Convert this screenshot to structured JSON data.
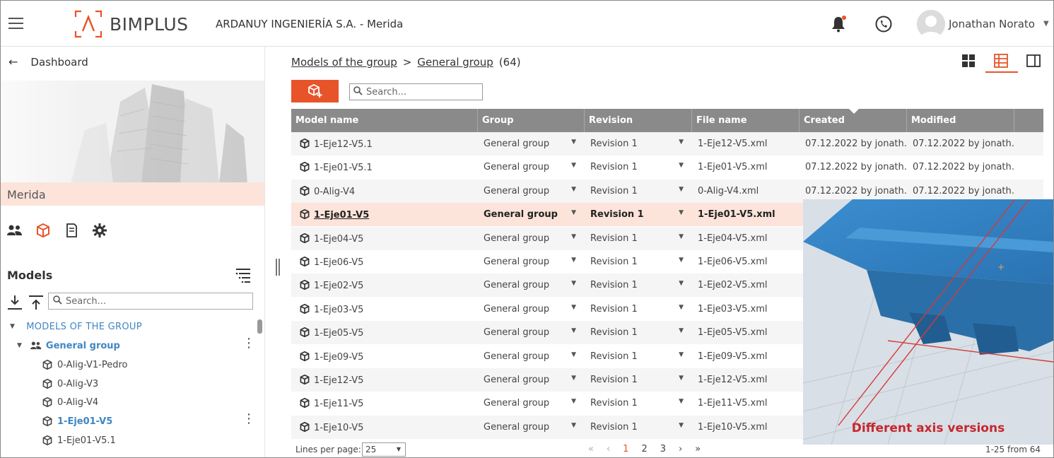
{
  "header": {
    "logo_text": "BIMPLUS",
    "company": "ARDANUY INGENIERÍA S.A.  -  Merida",
    "user_name": "Jonathan Norato"
  },
  "sidebar": {
    "back_label": "Dashboard",
    "project_name": "Merida",
    "models_title": "Models",
    "search_placeholder": "Search...",
    "tree": {
      "root_label": "MODELS OF THE GROUP",
      "group_label": "General group",
      "models": [
        "0-Alig-V1-Pedro",
        "0-Alig-V3",
        "0-Alig-V4",
        "1-Eje01-V5",
        "1-Eje01-V5.1"
      ],
      "selected_model": "1-Eje01-V5"
    }
  },
  "main": {
    "breadcrumb": {
      "root": "Models of the group",
      "separator": ">",
      "current": "General group",
      "count": "(64)"
    },
    "search_placeholder": "Search...",
    "columns": [
      "Model name",
      "Group",
      "Revision",
      "File name",
      "Created",
      "Modified"
    ],
    "rows": [
      {
        "name": "1-Eje12-V5.1",
        "group": "General group",
        "revision": "Revision 1",
        "file": "1-Eje12-V5.xml",
        "created": "07.12.2022 by jonath…",
        "modified": "07.12.2022 by jonath…"
      },
      {
        "name": "1-Eje01-V5.1",
        "group": "General group",
        "revision": "Revision 1",
        "file": "1-Eje01-V5.xml",
        "created": "07.12.2022 by jonath…",
        "modified": "07.12.2022 by jonath…"
      },
      {
        "name": "0-Alig-V4",
        "group": "General group",
        "revision": "Revision 1",
        "file": "0-Alig-V4.xml",
        "created": "07.12.2022 by jonath…",
        "modified": "07.12.2022 by jonath…"
      },
      {
        "name": "1-Eje01-V5",
        "group": "General group",
        "revision": "Revision 1",
        "file": "1-Eje01-V5.xml",
        "created": "",
        "modified": ""
      },
      {
        "name": "1-Eje04-V5",
        "group": "General group",
        "revision": "Revision 1",
        "file": "1-Eje04-V5.xml",
        "created": "",
        "modified": ""
      },
      {
        "name": "1-Eje06-V5",
        "group": "General group",
        "revision": "Revision 1",
        "file": "1-Eje06-V5.xml",
        "created": "",
        "modified": ""
      },
      {
        "name": "1-Eje02-V5",
        "group": "General group",
        "revision": "Revision 1",
        "file": "1-Eje02-V5.xml",
        "created": "",
        "modified": ""
      },
      {
        "name": "1-Eje03-V5",
        "group": "General group",
        "revision": "Revision 1",
        "file": "1-Eje03-V5.xml",
        "created": "",
        "modified": ""
      },
      {
        "name": "1-Eje05-V5",
        "group": "General group",
        "revision": "Revision 1",
        "file": "1-Eje05-V5.xml",
        "created": "",
        "modified": ""
      },
      {
        "name": "1-Eje09-V5",
        "group": "General group",
        "revision": "Revision 1",
        "file": "1-Eje09-V5.xml",
        "created": "",
        "modified": ""
      },
      {
        "name": "1-Eje12-V5",
        "group": "General group",
        "revision": "Revision 1",
        "file": "1-Eje12-V5.xml",
        "created": "",
        "modified": ""
      },
      {
        "name": "1-Eje11-V5",
        "group": "General group",
        "revision": "Revision 1",
        "file": "1-Eje11-V5.xml",
        "created": "",
        "modified": ""
      },
      {
        "name": "1-Eje10-V5",
        "group": "General group",
        "revision": "Revision 1",
        "file": "1-Eje10-V5.xml",
        "created": "",
        "modified": ""
      }
    ],
    "selected_row": 3,
    "overlay_caption": "Different axis versions"
  },
  "footer": {
    "lines_per_page_label": "Lines per page:",
    "lines_per_page_value": "25",
    "pages": [
      "1",
      "2",
      "3"
    ],
    "current_page": "1",
    "range_text": "1-25 from 64"
  },
  "colors": {
    "accent": "#e8542a",
    "header_bar": "#8a8a8a",
    "selection": "#fce4da",
    "tree_link": "#3f86c4",
    "model_blue": "#2f7fbf"
  },
  "icons": [
    "menu-icon",
    "bell-icon",
    "phone-icon",
    "user-avatar",
    "back-arrow-icon",
    "users-icon",
    "cube-icon",
    "document-icon",
    "gear-icon",
    "filter-list-icon",
    "expand-all-icon",
    "collapse-all-icon",
    "search-icon",
    "grid-view-icon",
    "table-view-icon",
    "panel-icon",
    "add-model-icon"
  ]
}
